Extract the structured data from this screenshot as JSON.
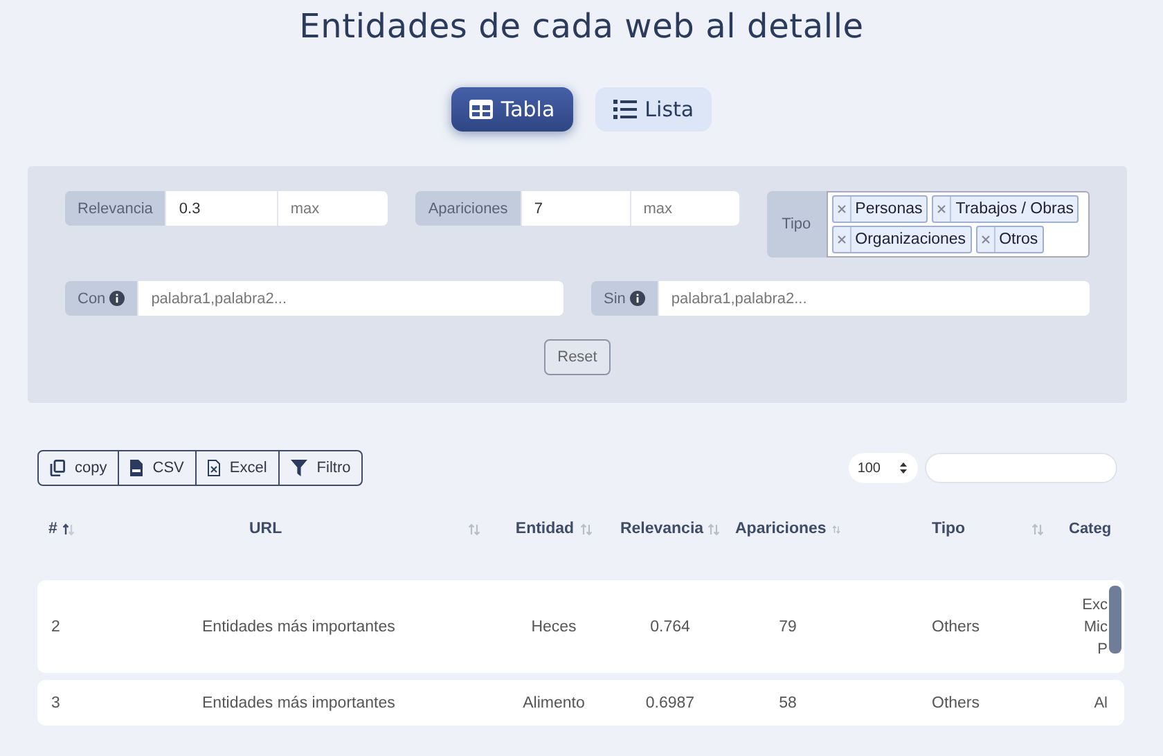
{
  "title": "Entidades de cada web al detalle",
  "view_toggle": [
    {
      "label": "Tabla",
      "kind": "table",
      "selected": true
    },
    {
      "label": "Lista",
      "kind": "list",
      "selected": false
    }
  ],
  "filters": {
    "range_filters": [
      {
        "label": "Relevancia",
        "min_value": "0.3",
        "max_placeholder": "max"
      },
      {
        "label": "Apariciones",
        "min_value": "7",
        "max_placeholder": "max"
      }
    ],
    "tipo": {
      "label": "Tipo",
      "tags": [
        "Personas",
        "Trabajos / Obras",
        "Organizaciones",
        "Otros"
      ]
    },
    "word_filters": [
      {
        "label": "Con",
        "placeholder": "palabra1,palabra2..."
      },
      {
        "label": "Sin",
        "placeholder": "palabra1,palabra2..."
      }
    ],
    "reset_label": "Reset"
  },
  "export_buttons": [
    {
      "kind": "copy",
      "label": "copy"
    },
    {
      "kind": "csv",
      "label": "CSV"
    },
    {
      "kind": "excel",
      "label": "Excel"
    },
    {
      "kind": "filter",
      "label": "Filtro"
    }
  ],
  "page_length": "100",
  "table": {
    "columns": [
      {
        "label": "#",
        "sorted_ascending": true
      },
      {
        "label": "URL",
        "sorted_ascending": false
      },
      {
        "label": "Entidad",
        "sorted_ascending": false
      },
      {
        "label": "Relevancia",
        "sorted_ascending": false
      },
      {
        "label": "Apariciones",
        "sorted_ascending": false
      },
      {
        "label": "Tipo",
        "sorted_ascending": false
      },
      {
        "label": "Categ"
      }
    ],
    "rows": [
      {
        "cells": [
          "2",
          "Entidades más importantes",
          "Heces",
          "0.764",
          "79",
          "Others",
          "Exc\nMic\nP"
        ]
      },
      {
        "cells": [
          "3",
          "Entidades más importantes",
          "Alimento",
          "0.6987",
          "58",
          "Others",
          "Al"
        ]
      }
    ]
  }
}
